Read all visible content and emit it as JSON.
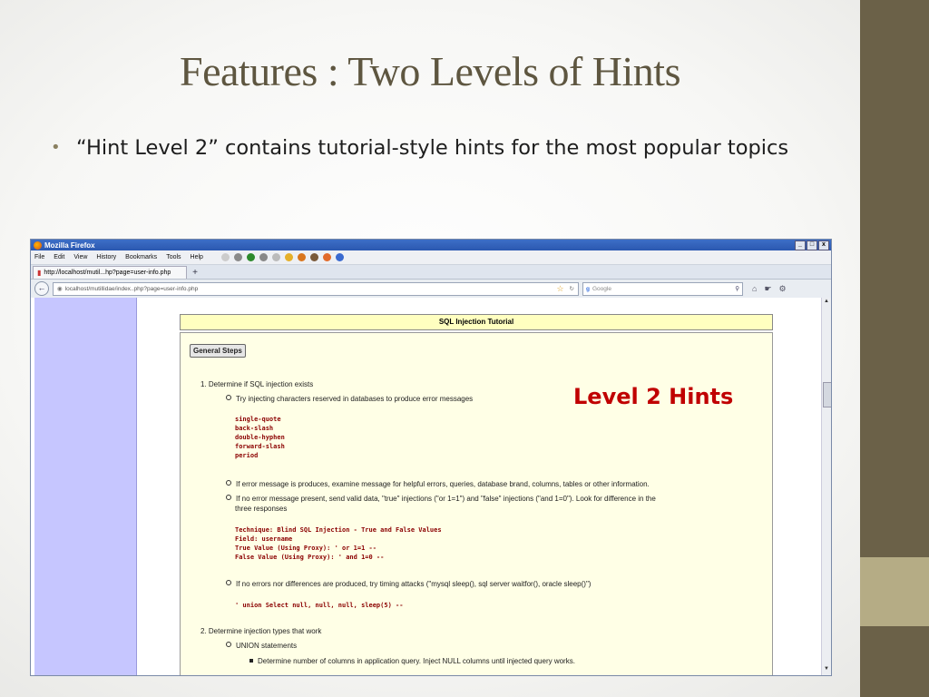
{
  "slide": {
    "title": "Features : Two Levels of Hints",
    "bullet": "“Hint Level 2” contains tutorial-style hints for the most popular topics",
    "bullet_symbol": "•",
    "overlay_label": "Level 2 Hints"
  },
  "browser": {
    "title": "Mozilla Firefox",
    "window_buttons": [
      "_",
      "□",
      "x"
    ],
    "menu": [
      "File",
      "Edit",
      "View",
      "History",
      "Bookmarks",
      "Tools",
      "Help"
    ],
    "tab_label": "http://localhost/mutil...hp?page=user-info.php",
    "tab_add": "+",
    "url": "localhost/mutillidae/index..php?page=user-info.php",
    "search_placeholder": "Google"
  },
  "tutorial": {
    "header": "SQL Injection Tutorial",
    "general_steps_button": "General Steps",
    "step1": "1.  Determine if SQL injection exists",
    "step1_a": "Try injecting characters reserved in databases to produce error messages",
    "chars": [
      "single-quote",
      "back-slash",
      "double-hyphen",
      "forward-slash",
      "period"
    ],
    "step1_b": "If error message is produces, examine message for helpful errors, queries, database brand, columns, tables or other information.",
    "step1_c1": "If no error message present, send valid data, \"true\" injections (\"or 1=1\") and \"false\" injections (\"and 1=0\"). Look for difference in the",
    "step1_c2": "three responses",
    "technique": [
      "Technique: Blind SQL Injection - True and False Values",
      "Field: username",
      "True Value (Using Proxy): ' or 1=1 --",
      "False Value (Using Proxy): ' and 1=0 --"
    ],
    "step1_d": "If no errors nor differences are produced, try timing attacks (\"mysql sleep(), sql server waitfor(), oracle sleep()\")",
    "union_code": "' union Select null, null, null, sleep(5) --",
    "step2": "2.  Determine injection types that work",
    "step2_a": "UNION statements",
    "step2_a_i": "Determine number of columns in application query. Inject NULL columns until injected query works."
  },
  "colors": {
    "sidebar_band": "#6b6148",
    "sidebar_accent": "#b5ac85",
    "title": "#5e5640",
    "hint_label": "#c00000",
    "code": "#8b0000"
  }
}
